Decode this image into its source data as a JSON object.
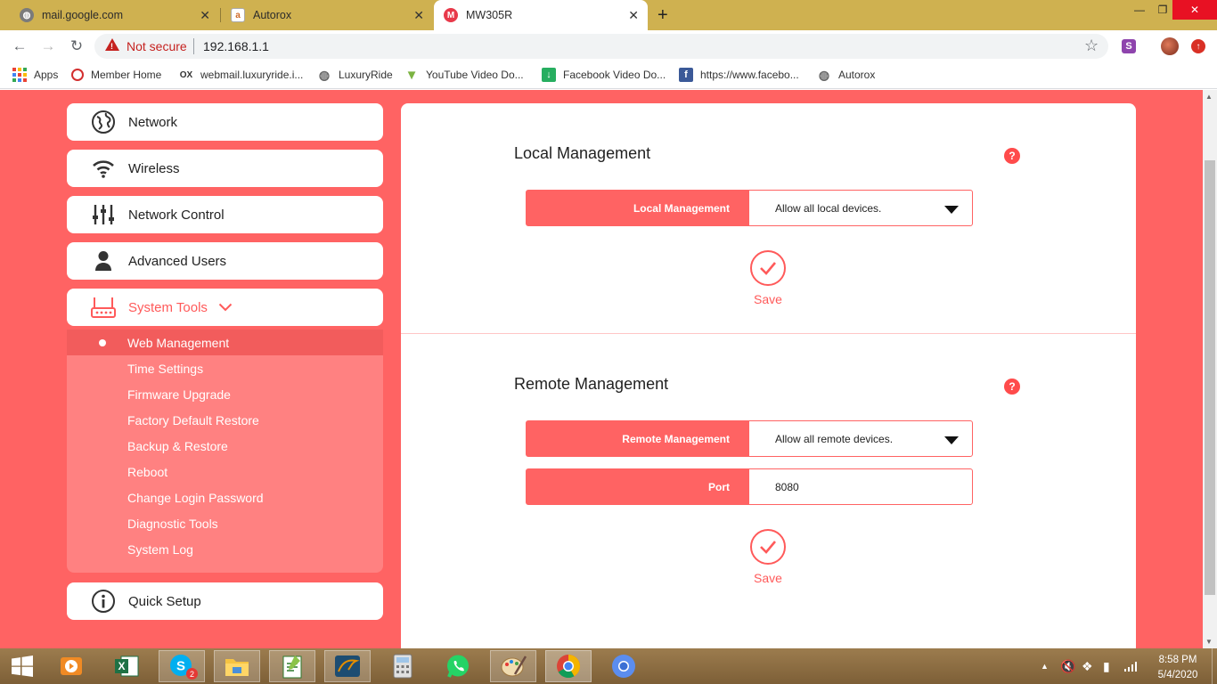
{
  "browser": {
    "tabs": [
      {
        "title": "mail.google.com"
      },
      {
        "title": "Autorox"
      },
      {
        "title": "MW305R"
      }
    ],
    "omnibox": {
      "security_label": "Not secure",
      "url": "192.168.1.1"
    },
    "bookmarks": [
      {
        "label": "Apps"
      },
      {
        "label": "Member Home"
      },
      {
        "label": "webmail.luxuryride.i..."
      },
      {
        "label": "LuxuryRide"
      },
      {
        "label": "YouTube Video Do..."
      },
      {
        "label": "Facebook Video Do..."
      },
      {
        "label": "https://www.facebo..."
      },
      {
        "label": "Autorox"
      }
    ]
  },
  "sidebar": {
    "items": [
      {
        "label": "Network",
        "icon": "globe-icon"
      },
      {
        "label": "Wireless",
        "icon": "wifi-icon"
      },
      {
        "label": "Network Control",
        "icon": "sliders-icon"
      },
      {
        "label": "Advanced Users",
        "icon": "user-icon"
      },
      {
        "label": "System Tools",
        "icon": "router-icon"
      }
    ],
    "submenu": [
      {
        "label": "Web Management"
      },
      {
        "label": "Time Settings"
      },
      {
        "label": "Firmware Upgrade"
      },
      {
        "label": "Factory Default Restore"
      },
      {
        "label": "Backup & Restore"
      },
      {
        "label": "Reboot"
      },
      {
        "label": "Change Login Password"
      },
      {
        "label": "Diagnostic Tools"
      },
      {
        "label": "System Log"
      }
    ],
    "quick_setup": {
      "label": "Quick Setup",
      "icon": "info-icon"
    }
  },
  "local": {
    "title": "Local Management",
    "field_label": "Local Management",
    "field_value": "Allow all local devices.",
    "save_label": "Save"
  },
  "remote": {
    "title": "Remote Management",
    "field_label": "Remote Management",
    "field_value": "Allow all remote devices.",
    "port_label": "Port",
    "port_value": "8080",
    "save_label": "Save"
  },
  "taskbar": {
    "time": "8:58 PM",
    "date": "5/4/2020",
    "skype_badge": "2"
  },
  "colors": {
    "accent": "#ff6363",
    "chrome_frame": "#cfb150",
    "submenu_bg": "#ff8181",
    "selected_sub": "#f25c5c"
  }
}
